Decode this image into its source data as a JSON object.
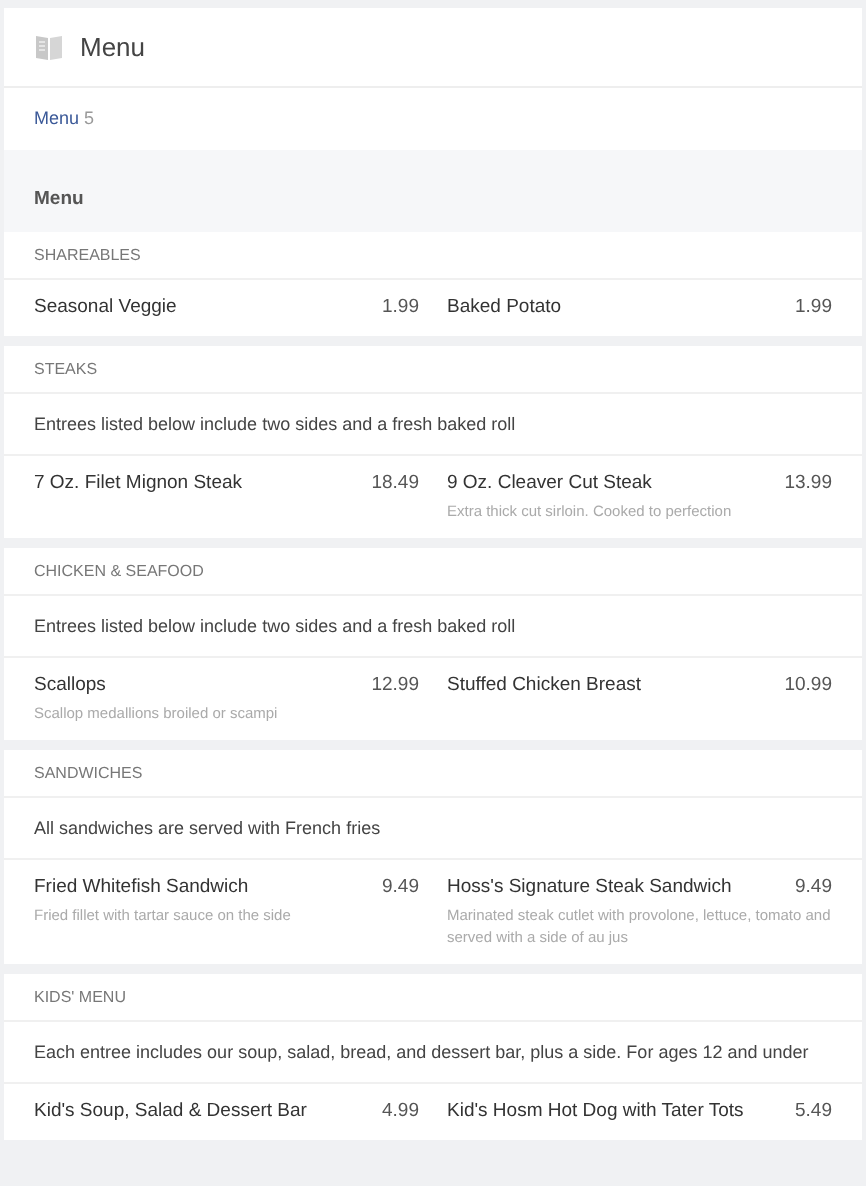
{
  "header": {
    "title": "Menu"
  },
  "tabs": [
    {
      "label": "Menu",
      "count": "5",
      "selected": true
    }
  ],
  "menu_title": "Menu",
  "sections": [
    {
      "title": "SHAREABLES",
      "items": [
        {
          "name": "Seasonal Veggie",
          "price": "1.99"
        },
        {
          "name": "Baked Potato",
          "price": "1.99"
        }
      ]
    },
    {
      "title": "STEAKS",
      "note": "Entrees listed below include two sides and a fresh baked roll",
      "items": [
        {
          "name": "7 Oz. Filet Mignon Steak",
          "price": "18.49"
        },
        {
          "name": "9 Oz. Cleaver Cut Steak",
          "price": "13.99",
          "description": "Extra thick cut sirloin. Cooked to perfection"
        }
      ]
    },
    {
      "title": "CHICKEN & SEAFOOD",
      "note": "Entrees listed below include two sides and a fresh baked roll",
      "items": [
        {
          "name": "Scallops",
          "price": "12.99",
          "description": "Scallop medallions broiled or scampi"
        },
        {
          "name": "Stuffed Chicken Breast",
          "price": "10.99"
        }
      ]
    },
    {
      "title": "SANDWICHES",
      "note": "All sandwiches are served with French fries",
      "items": [
        {
          "name": "Fried Whitefish Sandwich",
          "price": "9.49",
          "description": "Fried fillet with tartar sauce on the side"
        },
        {
          "name": "Hoss's Signature Steak Sandwich",
          "price": "9.49",
          "description": "Marinated steak cutlet with provolone, lettuce, tomato and served with a side of au jus"
        }
      ]
    },
    {
      "title": "KIDS' MENU",
      "note": "Each entree includes our soup, salad, bread, and dessert bar, plus a side. For ages 12 and under",
      "items": [
        {
          "name": "Kid's Soup, Salad & Dessert Bar",
          "price": "4.99"
        },
        {
          "name": "Kid's Hosm Hot Dog with Tater Tots",
          "price": "5.49"
        }
      ]
    }
  ]
}
